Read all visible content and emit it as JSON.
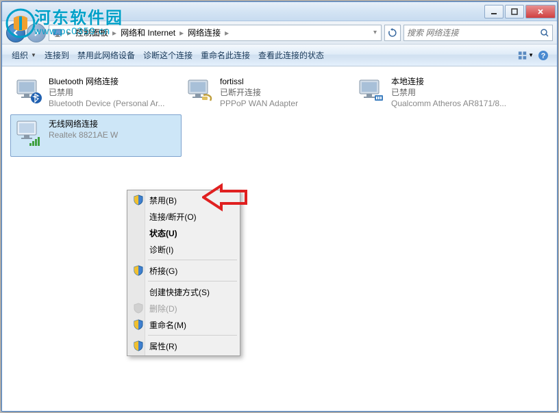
{
  "watermark": {
    "line1": "河东软件园",
    "line2": "www.pc0359.cn"
  },
  "titlebar": {
    "minimize": "–",
    "maximize": "□",
    "close": "✕"
  },
  "breadcrumb": {
    "root": "",
    "items": [
      "控制面板",
      "网络和 Internet",
      "网络连接"
    ]
  },
  "search": {
    "placeholder": "搜索 网络连接"
  },
  "toolbar": {
    "organize": "组织",
    "connect_to": "连接到",
    "disable_device": "禁用此网络设备",
    "diagnose": "诊断这个连接",
    "rename": "重命名此连接",
    "view_status": "查看此连接的状态"
  },
  "connections": [
    {
      "name": "Bluetooth 网络连接",
      "status": "已禁用",
      "device": "Bluetooth Device (Personal Ar...",
      "icon": "bluetooth"
    },
    {
      "name": "fortissl",
      "status": "已断开连接",
      "device": "PPPoP WAN Adapter",
      "icon": "dialup"
    },
    {
      "name": "本地连接",
      "status": "已禁用",
      "device": "Qualcomm Atheros AR8171/8...",
      "icon": "ethernet"
    },
    {
      "name": "无线网络连接",
      "status": "",
      "device": "Realtek 8821AE W",
      "icon": "wifi",
      "selected": true
    }
  ],
  "context_menu": {
    "disable": "禁用(B)",
    "connect_disconnect": "连接/断开(O)",
    "status": "状态(U)",
    "diagnose": "诊断(I)",
    "bridge": "桥接(G)",
    "create_shortcut": "创建快捷方式(S)",
    "delete": "删除(D)",
    "rename": "重命名(M)",
    "properties": "属性(R)"
  }
}
